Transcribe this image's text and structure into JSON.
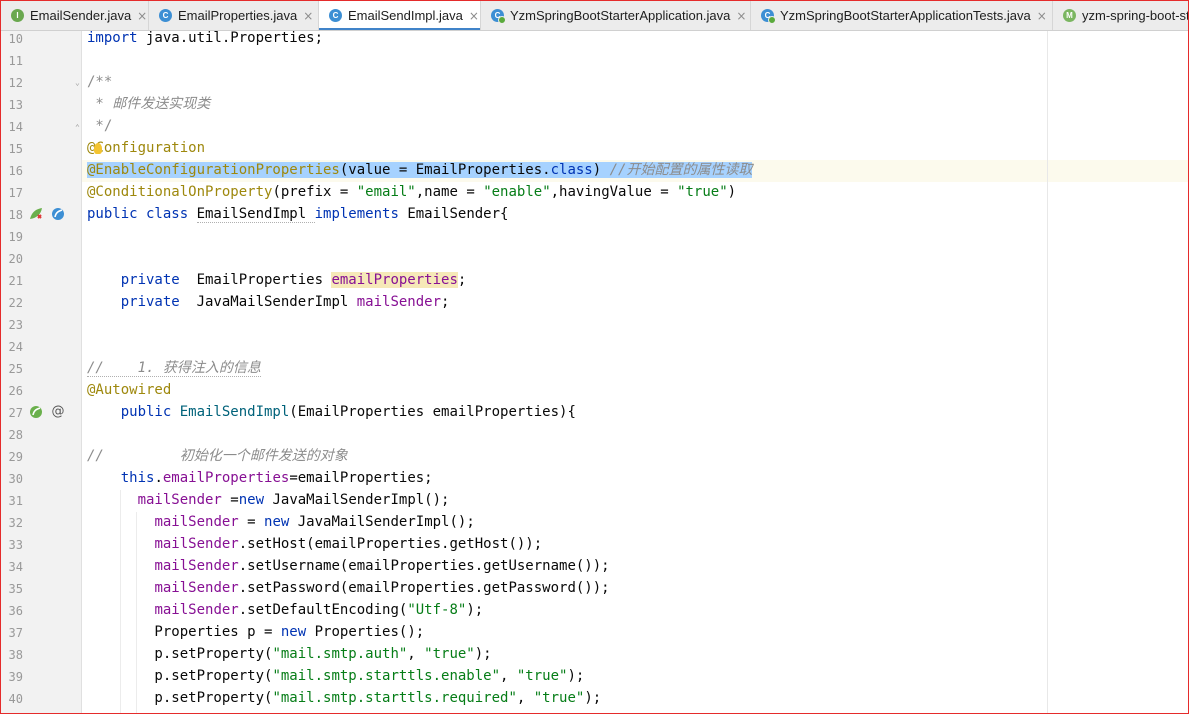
{
  "tabs": [
    {
      "label": "EmailSender.java",
      "icon": "I",
      "type": "interface",
      "active": false
    },
    {
      "label": "EmailProperties.java",
      "icon": "C",
      "type": "class",
      "active": false
    },
    {
      "label": "EmailSendImpl.java",
      "icon": "C",
      "type": "class",
      "active": true
    },
    {
      "label": "YzmSpringBootStarterApplication.java",
      "icon": "C",
      "type": "spring-class",
      "active": false
    },
    {
      "label": "YzmSpringBootStarterApplicationTests.java",
      "icon": "C",
      "type": "spring-class",
      "active": false
    },
    {
      "label": "yzm-spring-boot-st",
      "icon": "M",
      "type": "module",
      "active": false
    }
  ],
  "tab_close_glyph": "×",
  "line_numbers": [
    "10",
    "11",
    "12",
    "13",
    "14",
    "15",
    "16",
    "17",
    "18",
    "19",
    "20",
    "21",
    "22",
    "23",
    "24",
    "25",
    "26",
    "27",
    "28",
    "29",
    "30",
    "31",
    "32",
    "33",
    "34",
    "35",
    "36",
    "37",
    "38",
    "39",
    "40"
  ],
  "code": {
    "l10": [
      "import",
      " java.util.Properties;"
    ],
    "l12": "/**",
    "l13": " * 邮件发送实现类",
    "l14": " */",
    "l15": [
      "@",
      "Configuration"
    ],
    "l16": [
      "@EnableConfigurationProperties",
      "(value = EmailProperties.",
      "class",
      ") ",
      "//开始配置的属性读取"
    ],
    "l17": [
      "@ConditionalOnProperty",
      "(prefix = ",
      "\"email\"",
      ",name = ",
      "\"enable\"",
      ",havingValue = ",
      "\"true\"",
      ")"
    ],
    "l18": [
      "public class ",
      "EmailSendImpl ",
      "implements ",
      "EmailSender{"
    ],
    "l21": [
      "    private  ",
      "EmailProperties ",
      "emailProperties",
      ";"
    ],
    "l22": [
      "    private  ",
      "JavaMailSenderImpl ",
      "mailSender",
      ";"
    ],
    "l25": [
      "//    1. 获得注入的信息"
    ],
    "l26": "@Autowired",
    "l27": [
      "    public ",
      "EmailSendImpl",
      "(EmailProperties emailProperties){"
    ],
    "l29": [
      "//         初始化一个邮件发送的对象"
    ],
    "l30": [
      "    ",
      "this",
      ".",
      "emailProperties",
      "=emailProperties;"
    ],
    "l31": [
      "      ",
      "mailSender",
      " =",
      "new",
      " JavaMailSenderImpl();"
    ],
    "l32": [
      "        ",
      "mailSender",
      " = ",
      "new",
      " JavaMailSenderImpl();"
    ],
    "l33": [
      "        ",
      "mailSender",
      ".setHost(emailProperties.getHost());"
    ],
    "l34": [
      "        ",
      "mailSender",
      ".setUsername(emailProperties.getUsername());"
    ],
    "l35": [
      "        ",
      "mailSender",
      ".setPassword(emailProperties.getPassword());"
    ],
    "l36": [
      "        ",
      "mailSender",
      ".setDefaultEncoding(",
      "\"Utf-8\"",
      ");"
    ],
    "l37": [
      "        Properties p = ",
      "new",
      " Properties();"
    ],
    "l38": [
      "        p.setProperty(",
      "\"mail.smtp.auth\"",
      ", ",
      "\"true\"",
      ");"
    ],
    "l39": [
      "        p.setProperty(",
      "\"mail.smtp.starttls.enable\"",
      ", ",
      "\"true\"",
      ");"
    ],
    "l40": [
      "        p.setProperty(",
      "\"mail.smtp.starttls.required\"",
      ", ",
      "\"true\"",
      ");"
    ]
  },
  "gutter_icons": {
    "l27_at": "@"
  },
  "colors": {
    "keyword": "#0033b3",
    "string": "#067d17",
    "annotation": "#9e880d",
    "field": "#871094",
    "comment": "#8c8c8c",
    "selection": "#a6d2ff",
    "active_tab_underline": "#4083c9"
  }
}
